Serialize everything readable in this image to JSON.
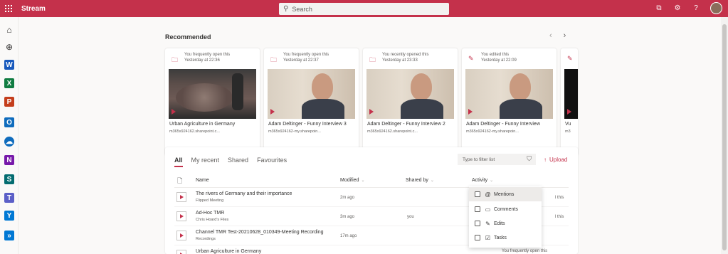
{
  "app": {
    "title": "Stream"
  },
  "search": {
    "placeholder": "Search"
  },
  "recommended": {
    "title": "Recommended",
    "cards": [
      {
        "reason": "You frequently open this",
        "time": "Yesterday at 22:36",
        "title": "Urban Agriculture in Germany",
        "site": "m365x924162.sharepoint.c..."
      },
      {
        "reason": "You frequently open this",
        "time": "Yesterday at 22:37",
        "title": "Adam Deltinger - Funny Interview 3",
        "site": "m365x924162-my.sharepoin..."
      },
      {
        "reason": "You recently opened this",
        "time": "Yesterday at 23:33",
        "title": "Adam Deltinger - Funny Interview 2",
        "site": "m365x924162.sharepoint.c..."
      },
      {
        "reason": "You edited this",
        "time": "Yesterday at 22:09",
        "title": "Adam Deltinger - Funny Interview",
        "site": "m365x924162-my.sharepoin..."
      },
      {
        "reason": "",
        "time": "",
        "title": "Vu",
        "site": "m3"
      }
    ]
  },
  "list": {
    "tabs": [
      "All",
      "My recent",
      "Shared",
      "Favourites"
    ],
    "filter_placeholder": "Type to filter list",
    "upload_label": "Upload",
    "columns": {
      "name": "Name",
      "modified": "Modified",
      "shared_by": "Shared by",
      "activity": "Activity"
    },
    "rows": [
      {
        "name": "The rivers of Germany and their importance",
        "location": "Flipped Meeting",
        "modified": "2m ago",
        "shared_by": "",
        "activity": ""
      },
      {
        "name": "Ad-Hoc TMR",
        "location": "Chris Hoard's Files",
        "modified": "3m ago",
        "shared_by": "you",
        "activity": ""
      },
      {
        "name": "Channel TMR Test-20210628_010349-Meeting Recording",
        "location": "Recordings",
        "modified": "17m ago",
        "shared_by": "",
        "activity": ""
      },
      {
        "name": "Urban Agriculture in Germany",
        "location": "",
        "modified": "",
        "shared_by": "",
        "activity": "You frequently open this"
      }
    ],
    "partial_activity": [
      "l this",
      "l this"
    ]
  },
  "activity_filter": {
    "items": [
      {
        "label": "Mentions",
        "icon": "at-icon",
        "glyph": "@"
      },
      {
        "label": "Comments",
        "icon": "comment-icon",
        "glyph": "▭"
      },
      {
        "label": "Edits",
        "icon": "pencil-icon",
        "glyph": "✎"
      },
      {
        "label": "Tasks",
        "icon": "task-icon",
        "glyph": "☑"
      }
    ]
  },
  "colors": {
    "brand": "#c4314b",
    "background": "#faf9f8"
  }
}
